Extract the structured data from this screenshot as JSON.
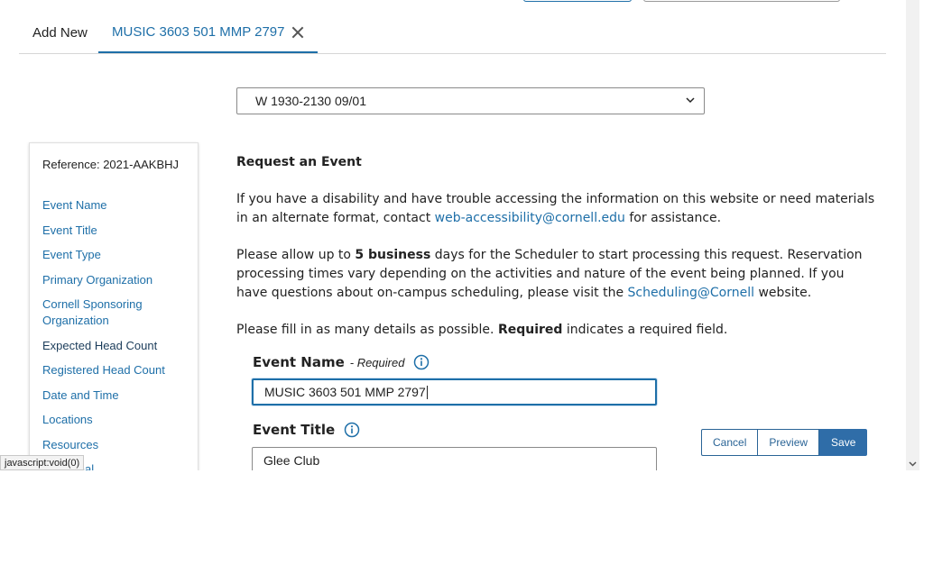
{
  "tabs": {
    "add_new": "Add New",
    "active": "MUSIC 3603 501 MMP 2797"
  },
  "occurrence_select": {
    "value": "W 1930-2130 09/01"
  },
  "nav": {
    "reference": "Reference: 2021-AAKBHJ",
    "items": [
      {
        "label": "Event Name"
      },
      {
        "label": "Event Title"
      },
      {
        "label": "Event Type"
      },
      {
        "label": "Primary Organization"
      },
      {
        "label": "Cornell Sponsoring Organization"
      },
      {
        "label": "Expected Head Count"
      },
      {
        "label": "Registered Head Count"
      },
      {
        "label": "Date and Time"
      },
      {
        "label": "Locations"
      },
      {
        "label": "Resources"
      },
      {
        "label": "Additional"
      }
    ]
  },
  "content": {
    "heading": "Request an Event",
    "p1_before": "If you have a disability and have trouble accessing the information on this website or need materials in an alternate format, contact ",
    "p1_link": "web-accessibility@cornell.edu",
    "p1_after": " for assistance.",
    "p2_before": "Please allow up to ",
    "p2_bold": "5 business",
    "p2_mid": " days for the Scheduler to start processing this request. Reservation processing times vary depending on the activities and nature of the event being planned. If you have questions about on-campus scheduling, please visit the ",
    "p2_link": "Scheduling@Cornell",
    "p2_after": " website.",
    "p3_before": "Please fill in as many details as possible. ",
    "p3_bold": "Required",
    "p3_after": " indicates a required field."
  },
  "form": {
    "event_name_label": "Event Name",
    "event_name_required": "- Required",
    "event_name_value": "MUSIC 3603 501 MMP 2797",
    "event_title_label": "Event Title",
    "event_title_value": "Glee Club"
  },
  "actions": {
    "cancel": "Cancel",
    "preview": "Preview",
    "save": "Save"
  },
  "status_bar": "javascript:void(0)",
  "colors": {
    "link": "#1e6fa8",
    "primary_button": "#2f6da8"
  }
}
